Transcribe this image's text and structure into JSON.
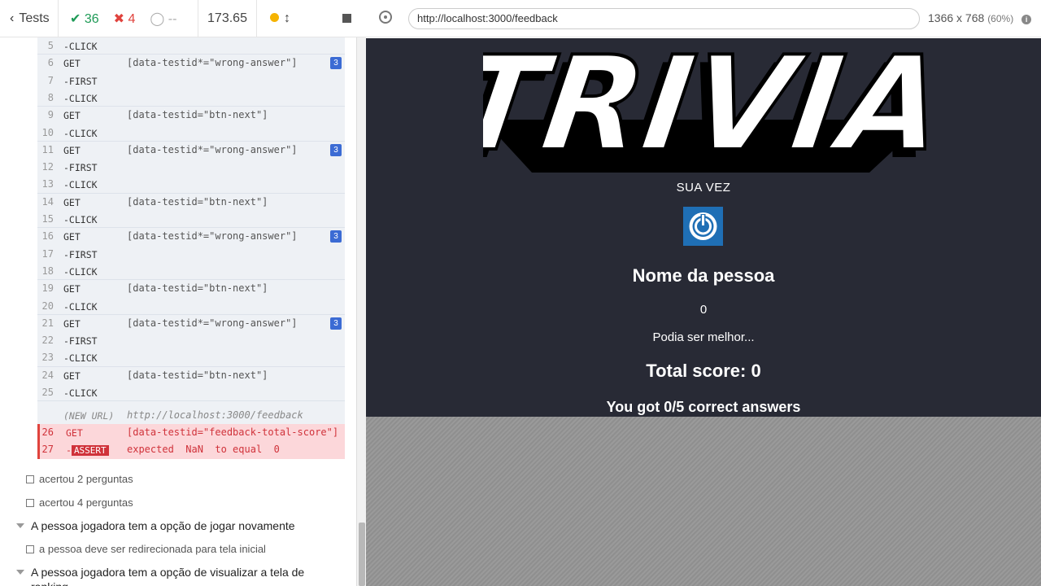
{
  "reporter": {
    "back_label": "Tests",
    "passed": "36",
    "failed": "4",
    "pending": "--",
    "duration": "173.65"
  },
  "commands": [
    {
      "num": "5",
      "cmd": "-CLICK",
      "sel": ""
    },
    {
      "num": "6",
      "cmd": "GET",
      "sel": "[data-testid*=\"wrong-answer\"]",
      "badge": "3"
    },
    {
      "num": "7",
      "cmd": "-FIRST",
      "sel": ""
    },
    {
      "num": "8",
      "cmd": "-CLICK",
      "sel": ""
    },
    {
      "num": "9",
      "cmd": "GET",
      "sel": "[data-testid=\"btn-next\"]"
    },
    {
      "num": "10",
      "cmd": "-CLICK",
      "sel": ""
    },
    {
      "num": "11",
      "cmd": "GET",
      "sel": "[data-testid*=\"wrong-answer\"]",
      "badge": "3"
    },
    {
      "num": "12",
      "cmd": "-FIRST",
      "sel": ""
    },
    {
      "num": "13",
      "cmd": "-CLICK",
      "sel": ""
    },
    {
      "num": "14",
      "cmd": "GET",
      "sel": "[data-testid=\"btn-next\"]"
    },
    {
      "num": "15",
      "cmd": "-CLICK",
      "sel": ""
    },
    {
      "num": "16",
      "cmd": "GET",
      "sel": "[data-testid*=\"wrong-answer\"]",
      "badge": "3"
    },
    {
      "num": "17",
      "cmd": "-FIRST",
      "sel": ""
    },
    {
      "num": "18",
      "cmd": "-CLICK",
      "sel": ""
    },
    {
      "num": "19",
      "cmd": "GET",
      "sel": "[data-testid=\"btn-next\"]"
    },
    {
      "num": "20",
      "cmd": "-CLICK",
      "sel": ""
    },
    {
      "num": "21",
      "cmd": "GET",
      "sel": "[data-testid*=\"wrong-answer\"]",
      "badge": "3"
    },
    {
      "num": "22",
      "cmd": "-FIRST",
      "sel": ""
    },
    {
      "num": "23",
      "cmd": "-CLICK",
      "sel": ""
    },
    {
      "num": "24",
      "cmd": "GET",
      "sel": "[data-testid=\"btn-next\"]"
    },
    {
      "num": "25",
      "cmd": "-CLICK",
      "sel": ""
    }
  ],
  "new_url": {
    "label": "(NEW URL)",
    "url": "http://localhost:3000/feedback"
  },
  "error": {
    "num1": "26",
    "cmd1": "GET",
    "sel1": "[data-testid=\"feedback-total-score\"]",
    "num2": "27",
    "cmd2": "ASSERT",
    "msg": "expected  NaN  to equal  0"
  },
  "tests": {
    "t1": "acertou 2 perguntas",
    "t2": "acertou 4 perguntas",
    "suite1": "A pessoa jogadora tem a opção de jogar novamente",
    "t3": "a pessoa deve ser redirecionada para tela inicial",
    "suite2": "A pessoa jogadora tem a opção de visualizar a tela de",
    "suite2b": "ranking"
  },
  "browser": {
    "url": "http://localhost:3000/feedback",
    "viewport": "1366 x 768",
    "scale": "(60%)"
  },
  "app": {
    "logo_text": "TRIVIA",
    "turn_label": "SUA VEZ",
    "player_name": "Nome da pessoa",
    "player_score": "0",
    "message": "Podia ser melhor...",
    "total_score": "Total score: 0",
    "correct_answers": "You got 0/5 correct answers"
  },
  "colors": {
    "pass": "#1e9a56",
    "fail": "#e0433d",
    "app_bg": "#282a35",
    "avatar_bg": "#1f6fb5"
  }
}
